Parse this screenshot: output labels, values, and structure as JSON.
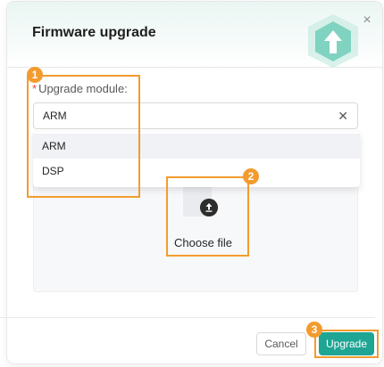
{
  "dialog": {
    "title": "Firmware upgrade",
    "close_icon": "close-icon"
  },
  "form": {
    "required_mark": "*",
    "module_label": "Upgrade module:",
    "module_value": "ARM",
    "clear_icon": "close-icon",
    "options": [
      {
        "label": "ARM",
        "selected": true
      },
      {
        "label": "DSP",
        "selected": false
      }
    ]
  },
  "upload": {
    "icon": "upload-icon",
    "label": "Choose file"
  },
  "footer": {
    "cancel_label": "Cancel",
    "upgrade_label": "Upgrade"
  },
  "callouts": {
    "badge_1": "1",
    "badge_2": "2",
    "badge_3": "3",
    "color": "#f39b2f"
  },
  "colors": {
    "accent": "#1fa594",
    "required": "#e64b3b"
  }
}
